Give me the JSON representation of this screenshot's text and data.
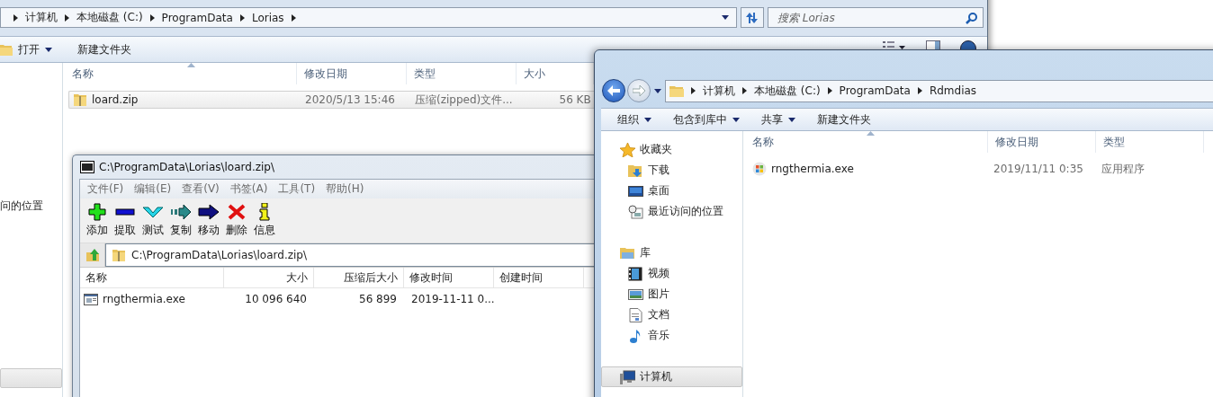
{
  "back_window": {
    "breadcrumb": [
      "计算机",
      "本地磁盘 (C:)",
      "ProgramData",
      "Lorias"
    ],
    "search": {
      "placeholder": "搜索 Lorias"
    },
    "toolbar": [
      {
        "label": "打开",
        "kind": "open"
      },
      {
        "label": "新建文件夹",
        "kind": "plain"
      }
    ],
    "sidebar": [
      {
        "label": "问的位置",
        "selected": false
      }
    ],
    "columns": [
      "名称",
      "修改日期",
      "类型",
      "大小"
    ],
    "rows": [
      {
        "name": "loard.zip",
        "date": "2020/5/13 15:46",
        "type": "压缩(zipped)文件...",
        "size": "56 KB",
        "selected": true
      }
    ]
  },
  "archive_window": {
    "title": "C:\\ProgramData\\Lorias\\loard.zip\\",
    "menu": [
      "文件(F)",
      "编辑(E)",
      "查看(V)",
      "书签(A)",
      "工具(T)",
      "帮助(H)"
    ],
    "tools": [
      {
        "label": "添加",
        "kind": "add"
      },
      {
        "label": "提取",
        "kind": "extract"
      },
      {
        "label": "测试",
        "kind": "test"
      },
      {
        "label": "复制",
        "kind": "copy"
      },
      {
        "label": "移动",
        "kind": "move"
      },
      {
        "label": "删除",
        "kind": "delete"
      },
      {
        "label": "信息",
        "kind": "info"
      }
    ],
    "path": "C:\\ProgramData\\Lorias\\loard.zip\\",
    "columns": [
      "名称",
      "大小",
      "压缩后大小",
      "修改时间",
      "创建时间"
    ],
    "rows": [
      {
        "name": "rngthermia.exe",
        "size": "10 096 640",
        "packed": "56 899",
        "modified": "2019-11-11 0..."
      }
    ]
  },
  "front_window": {
    "breadcrumb": [
      "计算机",
      "本地磁盘 (C:)",
      "ProgramData",
      "Rdmdias"
    ],
    "toolbar": [
      {
        "label": "组织",
        "kind": "menu"
      },
      {
        "label": "包含到库中",
        "kind": "menu"
      },
      {
        "label": "共享",
        "kind": "menu"
      },
      {
        "label": "新建文件夹",
        "kind": "plain"
      }
    ],
    "sidebar": [
      {
        "label": "收藏夹",
        "kind": "favorites",
        "selected": false,
        "children": [
          {
            "label": "下载",
            "kind": "download",
            "selected": false
          },
          {
            "label": "桌面",
            "kind": "desktop",
            "selected": false
          },
          {
            "label": "最近访问的位置",
            "kind": "recent",
            "selected": false
          }
        ]
      },
      {
        "label": "库",
        "kind": "library",
        "selected": false,
        "children": [
          {
            "label": "视频",
            "kind": "video",
            "selected": false
          },
          {
            "label": "图片",
            "kind": "pictures",
            "selected": false
          },
          {
            "label": "文档",
            "kind": "documents",
            "selected": false
          },
          {
            "label": "音乐",
            "kind": "music",
            "selected": false
          }
        ]
      },
      {
        "label": "计算机",
        "kind": "computer",
        "selected": true
      }
    ],
    "columns": [
      "名称",
      "修改日期",
      "类型"
    ],
    "rows": [
      {
        "name": "rngthermia.exe",
        "date": "2019/11/11 0:35",
        "type": "应用程序"
      }
    ]
  }
}
